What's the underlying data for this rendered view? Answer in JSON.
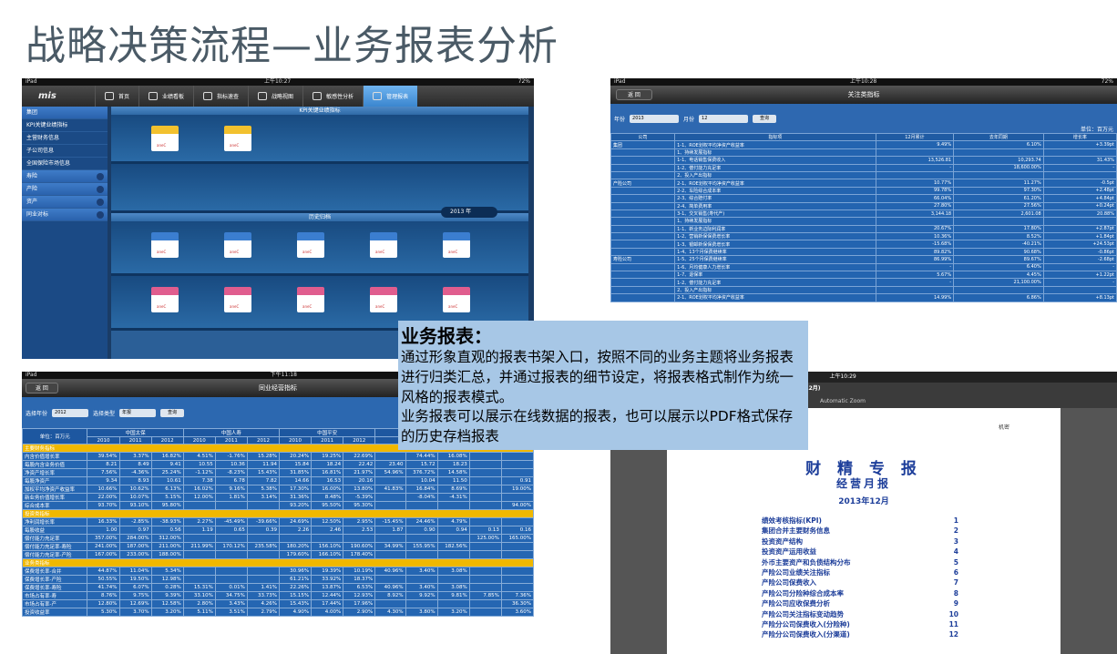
{
  "slide_title": "战略决策流程—业务报表分析",
  "note": {
    "title": "业务报表：",
    "p1": "通过形象直观的报表书架入口，按照不同的业务主题将业务报表进行归类汇总，并通过报表的细节设定，将报表格式制作为统一风格的报表模式。",
    "p2": "业务报表可以展示在线数据的报表，也可以展示以PDF格式保存的历史存档报表"
  },
  "s1": {
    "status_left": "iPad",
    "status_time": "上午10:27",
    "status_right": "72%",
    "nav": [
      "首页",
      "业绩看板",
      "指标速查",
      "战略视图",
      "敏感性分析",
      "管理报表"
    ],
    "logo": "mis",
    "side": [
      "集团",
      "KPI关键业绩指标",
      "主营财务信息",
      "子公司信息",
      "全国保险市场信息",
      "寿险",
      "产险",
      "资产",
      "同业对标"
    ],
    "band1": "KPI关键业绩指标",
    "band2": "历史归档",
    "year": "2013 年",
    "book_text": "aneC"
  },
  "s2": {
    "status_left": "iPad",
    "status_time": "上午10:28",
    "status_right": "72%",
    "title": "关注类指标",
    "back": "返 回",
    "year_label": "年份",
    "year": "2013",
    "month_label": "月份",
    "month": "12",
    "query": "查询",
    "unit": "单位：百万元",
    "headers": [
      "公司",
      "指标项",
      "12月累计",
      "去年同期",
      "增长率"
    ],
    "rows": [
      [
        "集团",
        "1-1、ROE划权平均净资产收益率",
        "9.49%",
        "6.10%",
        "+3.39pt"
      ],
      [
        "",
        "1、持续发展指标",
        "",
        "",
        ""
      ],
      [
        "",
        "1-1、电话销售保费收入",
        "13,526.81",
        "10,293.74",
        "31.43%"
      ],
      [
        "",
        "1-2、偿付能力充足率",
        "-",
        "18,600.00%",
        "-"
      ],
      [
        "",
        "2、投入产出指标",
        "",
        "",
        ""
      ],
      [
        "产险公司",
        "2-1、ROE划权平均净资产收益率",
        "10.77%",
        "11.27%",
        "-0.5pt"
      ],
      [
        "",
        "2-2、车险综合成本率",
        "99.78%",
        "97.30%",
        "+2.48pt"
      ],
      [
        "",
        "2-3、综合赔付率",
        "66.04%",
        "61.20%",
        "+4.84pt"
      ],
      [
        "",
        "2-4、简单费用率",
        "27.80%",
        "27.56%",
        "+0.24pt"
      ],
      [
        "",
        "3-1、交叉销售(寿代产)",
        "3,144.18",
        "2,601.08",
        "20.88%"
      ],
      [
        "",
        "1、持续发展指标",
        "",
        "",
        ""
      ],
      [
        "",
        "1-1、新业务边际利润率",
        "20.67%",
        "17.80%",
        "+2.87pt"
      ],
      [
        "",
        "1-2、营销新保保费增长率",
        "10.36%",
        "8.52%",
        "+1.84pt"
      ],
      [
        "",
        "1-3、银邮新保保费增长率",
        "-15.68%",
        "-40.21%",
        "+24.53pt"
      ],
      [
        "",
        "1-4、13个月保费继续率",
        "89.82%",
        "90.68%",
        "-0.86pt"
      ],
      [
        "寿险公司",
        "1-5、25个月保费继续率",
        "86.99%",
        "89.67%",
        "-2.68pt"
      ],
      [
        "",
        "1-6、月均健康人力增长率",
        "-",
        "6.40%",
        "-"
      ],
      [
        "",
        "1-7、退保率",
        "5.67%",
        "4.45%",
        "+1.22pt"
      ],
      [
        "",
        "1-2、偿付能力充足率",
        "-",
        "21,100.00%",
        "-"
      ],
      [
        "",
        "2、投入产出指标",
        "",
        "",
        ""
      ],
      [
        "",
        "2-1、ROE划权平均净资产收益率",
        "14.99%",
        "6.86%",
        "+8.13pt"
      ]
    ]
  },
  "s3": {
    "status_left": "iPad",
    "status_time": "下午11:18",
    "title": "同业经营指标",
    "back": "返 回",
    "year_label": "选择年份",
    "year": "2012",
    "type_label": "选择类型",
    "type": "年报",
    "query": "查询",
    "unit": "单位：百万元",
    "companies": [
      "中国太保",
      "中国人寿",
      "中国平安"
    ],
    "years": [
      "2010",
      "2011",
      "2012"
    ],
    "rows": [
      {
        "sec": "主要财务指标"
      },
      [
        "内含价值增长率",
        "39.54%",
        "3.37%",
        "16.82%",
        "4.51%",
        "-1.76%",
        "15.28%",
        "20.24%",
        "19.25%",
        "22.69%",
        "",
        "74.44%",
        "16.08%",
        "",
        ""
      ],
      [
        "每股内含业务价值",
        "8.21",
        "8.49",
        "9.41",
        "10.55",
        "10.36",
        "11.94",
        "15.84",
        "18.24",
        "22.42",
        "23.40",
        "15.72",
        "18.23",
        "",
        ""
      ],
      [
        "净资产增长率",
        "7.56%",
        "-4.36%",
        "25.24%",
        "-1.12%",
        "-8.23%",
        "15.43%",
        "31.85%",
        "16.81%",
        "21.97%",
        "54.96%",
        "376.72%",
        "14.58%",
        "",
        ""
      ],
      [
        "每股净资产",
        "9.34",
        "8.93",
        "10.61",
        "7.38",
        "6.78",
        "7.82",
        "14.66",
        "16.53",
        "20.16",
        "",
        "10.04",
        "11.50",
        "",
        "0.91"
      ],
      [
        "加权平均净资产收益率",
        "10.66%",
        "10.62%",
        "6.13%",
        "16.02%",
        "9.16%",
        "5.38%",
        "17.30%",
        "16.00%",
        "13.80%",
        "41.83%",
        "16.84%",
        "8.69%",
        "",
        "19.00%"
      ],
      [
        "新业务价值增长率",
        "22.00%",
        "10.07%",
        "5.15%",
        "12.00%",
        "1.81%",
        "3.14%",
        "31.36%",
        "8.48%",
        "-5.39%",
        "",
        "-8.04%",
        "-4.31%",
        "",
        ""
      ],
      [
        "综合成本率",
        "93.70%",
        "93.10%",
        "95.80%",
        "",
        "",
        "",
        "93.20%",
        "95.50%",
        "95.30%",
        "",
        "",
        "",
        "",
        "94.00%"
      ],
      {
        "sec": "投资类指标"
      },
      [
        "净利润增长率",
        "16.33%",
        "-2.85%",
        "-38.93%",
        "2.27%",
        "-45.49%",
        "-39.66%",
        "24.69%",
        "12.50%",
        "2.95%",
        "-15.45%",
        "24.46%",
        "4.79%",
        "",
        ""
      ],
      [
        "每股收益",
        "1.00",
        "0.97",
        "0.56",
        "1.19",
        "0.65",
        "0.39",
        "2.26",
        "2.46",
        "2.53",
        "1.87",
        "0.90",
        "0.94",
        "0.13",
        "0.16"
      ],
      [
        "偿付能力充足率",
        "357.00%",
        "284.00%",
        "312.00%",
        "",
        "",
        "",
        "",
        "",
        "",
        "",
        "",
        "",
        "125.00%",
        "165.00%"
      ],
      [
        "偿付能力充足率-寿险",
        "241.00%",
        "187.00%",
        "211.00%",
        "211.99%",
        "170.12%",
        "235.58%",
        "180.20%",
        "156.10%",
        "190.60%",
        "34.99%",
        "155.95%",
        "182.56%",
        "",
        ""
      ],
      [
        "偿付能力充足率-产险",
        "167.00%",
        "233.00%",
        "188.00%",
        "",
        "",
        "",
        "179.60%",
        "166.10%",
        "178.40%",
        "",
        "",
        "",
        "",
        ""
      ],
      {
        "sec": "业务类指标"
      },
      [
        "保费增长率-合并",
        "44.87%",
        "11.04%",
        "5.34%",
        "",
        "",
        "",
        "30.96%",
        "19.39%",
        "10.19%",
        "40.96%",
        "3.40%",
        "3.08%",
        "",
        ""
      ],
      [
        "保费增长率-产险",
        "50.55%",
        "19.50%",
        "12.98%",
        "",
        "",
        "",
        "61.21%",
        "33.92%",
        "18.37%",
        "",
        "",
        "",
        "",
        ""
      ],
      [
        "保费增长率-寿险",
        "41.74%",
        "6.07%",
        "0.28%",
        "15.31%",
        "0.01%",
        "1.41%",
        "22.26%",
        "13.87%",
        "6.53%",
        "40.96%",
        "3.40%",
        "3.08%",
        "",
        ""
      ],
      [
        "市场占有率-寿",
        "8.76%",
        "9.75%",
        "9.39%",
        "33.10%",
        "34.75%",
        "33.73%",
        "15.15%",
        "12.44%",
        "12.93%",
        "8.92%",
        "9.92%",
        "9.81%",
        "7.85%",
        "7.36%"
      ],
      [
        "市场占有率-产",
        "12.80%",
        "12.69%",
        "12.58%",
        "2.80%",
        "3.43%",
        "4.26%",
        "15.43%",
        "17.44%",
        "17.96%",
        "",
        "",
        "",
        "",
        "36.30%"
      ],
      [
        "投资收益率",
        "5.30%",
        "3.70%",
        "3.20%",
        "5.11%",
        "3.51%",
        "2.79%",
        "4.90%",
        "4.00%",
        "2.90%",
        "4.30%",
        "3.80%",
        "3.20%",
        "",
        "3.60%"
      ]
    ]
  },
  "s4": {
    "status_left": "iPad",
    "status_time": "上午10:29",
    "title": "集团经营月报(2013年12月)",
    "back": "返回",
    "zoom": "Automatic Zoom",
    "tag": "机密",
    "h1": "财 精 专 报",
    "h2": "经营月报",
    "h3": "2013年12月",
    "toc": [
      [
        "绩效考核指标(KPI)",
        "1"
      ],
      [
        "集团合并主要财务信息",
        "2"
      ],
      [
        "投资资产结构",
        "3"
      ],
      [
        "投资资产运用收益",
        "4"
      ],
      [
        "外币主要资产和负债结构分布",
        "5"
      ],
      [
        "产险公司业绩关注指标",
        "6"
      ],
      [
        "产险公司保费收入",
        "7"
      ],
      [
        "产险公司分险种综合成本率",
        "8"
      ],
      [
        "产险公司应收保费分析",
        "9"
      ],
      [
        "产险公司关注指标变动趋势",
        "10"
      ],
      [
        "产险分公司保费收入(分险种)",
        "11"
      ],
      [
        "产险分公司保费收入(分渠道)",
        "12"
      ]
    ]
  }
}
